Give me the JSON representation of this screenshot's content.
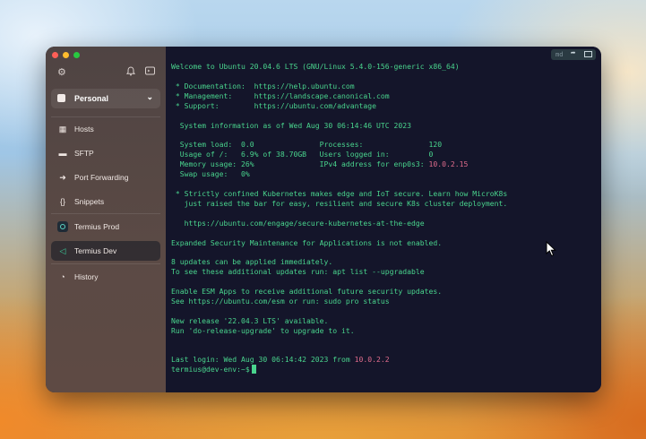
{
  "sidebar": {
    "vault_label": "Personal",
    "items": [
      {
        "label": "Hosts",
        "icon": "grid-icon"
      },
      {
        "label": "SFTP",
        "icon": "folder-icon"
      },
      {
        "label": "Port Forwarding",
        "icon": "arrow-right-icon"
      },
      {
        "label": "Snippets",
        "icon": "braces-icon"
      },
      {
        "label": "Termius Prod",
        "icon": "host-icon"
      },
      {
        "label": "Termius Dev",
        "icon": "terminal-icon"
      },
      {
        "label": "History",
        "icon": "clock-icon"
      }
    ]
  },
  "terminal": {
    "toolbar_label": "md",
    "welcome": "Welcome to Ubuntu 20.04.6 LTS (GNU/Linux 5.4.0-156-generic x86_64)",
    "doc": " * Documentation:  https://help.ubuntu.com",
    "mgmt": " * Management:     https://landscape.canonical.com",
    "support": " * Support:        https://ubuntu.com/advantage",
    "sysinfo": "  System information as of Wed Aug 30 06:14:46 UTC 2023",
    "row1": "  System load:  0.0               Processes:               120",
    "row2": "  Usage of /:   6.9% of 38.70GB   Users logged in:         0",
    "row3_prefix": "  Memory usage: 26%               IPv4 address for enp0s3: ",
    "row3_ip": "10.0.2.15",
    "row4": "  Swap usage:   0%",
    "k8s1": " * Strictly confined Kubernetes makes edge and IoT secure. Learn how MicroK8s",
    "k8s2": "   just raised the bar for easy, resilient and secure K8s cluster deployment.",
    "k8s_url": "   https://ubuntu.com/engage/secure-kubernetes-at-the-edge",
    "esm": "Expanded Security Maintenance for Applications is not enabled.",
    "updates1": "8 updates can be applied immediately.",
    "updates2": "To see these additional updates run: apt list --upgradable",
    "esmapps1": "Enable ESM Apps to receive additional future security updates.",
    "esmapps2": "See https://ubuntu.com/esm or run: sudo pro status",
    "release1": "New release '22.04.3 LTS' available.",
    "release2": "Run 'do-release-upgrade' to upgrade to it.",
    "lastlogin_prefix": "Last login: Wed Aug 30 06:14:42 2023 from ",
    "lastlogin_ip": "10.0.2.2",
    "prompt": "termius@dev-env:~$"
  }
}
